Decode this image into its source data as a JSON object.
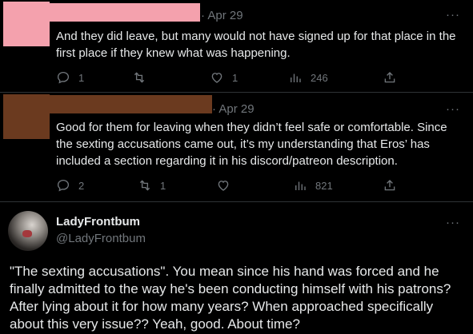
{
  "tweets": [
    {
      "date": "Apr 29",
      "text": "And they did leave, but many would not have signed up for that place in the first place if they knew what was happening.",
      "avatar_color": "#f4a1ad",
      "redaction_color": "#f4a1ad",
      "replies": "1",
      "retweets": "",
      "likes": "1",
      "views": "246"
    },
    {
      "date": "Apr 29",
      "text": "Good for them for leaving when they didn’t feel safe or comfortable. Since the sexting accusations came out, it’s my understanding that Eros’ has included a section regarding it in his discord/patreon description.",
      "avatar_color": "#6b3a1f",
      "redaction_color": "#6b3a1f",
      "replies": "2",
      "retweets": "1",
      "likes": "",
      "views": "821"
    }
  ],
  "main_tweet": {
    "display_name": "LadyFrontbum",
    "handle": "@LadyFrontbum",
    "text": "\"The sexting accusations\". You mean since his hand was forced and he finally admitted to the way he's been conducting himself with his patrons? After lying about it for how many years? When approached specifically about this very issue?? Yeah, good. About time?"
  },
  "more_label": "···",
  "separator": "·",
  "icons": [
    "reply-icon",
    "retweet-icon",
    "like-icon",
    "views-icon",
    "share-icon",
    "more-icon"
  ],
  "colors": {
    "background": "#000000",
    "text": "#e7e9ea",
    "muted": "#71767b"
  }
}
